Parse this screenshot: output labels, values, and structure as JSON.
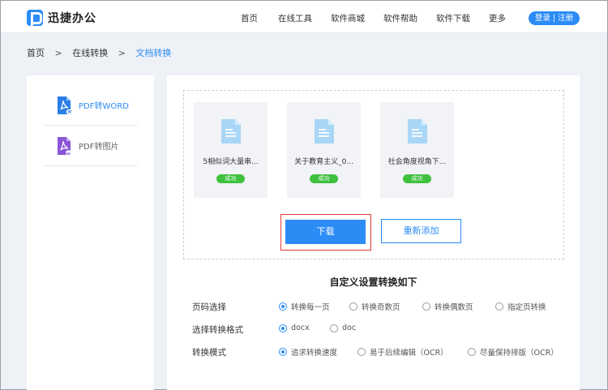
{
  "header": {
    "logo_text": "迅捷办公",
    "nav": [
      "首页",
      "在线工具",
      "软件商城",
      "软件帮助",
      "软件下载",
      "更多"
    ],
    "login_label": "登录 | 注册"
  },
  "breadcrumb": {
    "items": [
      "首页",
      "在线转换",
      "文档转换"
    ],
    "separator": ">"
  },
  "sidebar": {
    "items": [
      {
        "label": "PDF转WORD",
        "icon": "pdf-to-word-icon"
      },
      {
        "label": "PDF转图片",
        "icon": "pdf-to-image-icon"
      }
    ]
  },
  "files": [
    {
      "name": "5相似词大量串...",
      "status": "成功"
    },
    {
      "name": "关于教育主义_0...",
      "status": "成功"
    },
    {
      "name": "社会角度视角下...",
      "status": "成功"
    }
  ],
  "actions": {
    "download_label": "下载",
    "readd_label": "重新添加"
  },
  "settings": {
    "title": "自定义设置转换如下",
    "rows": [
      {
        "label": "页码选择",
        "options": [
          "转换每一页",
          "转换奇数页",
          "转换偶数页",
          "指定页转换"
        ],
        "selected": 0
      },
      {
        "label": "选择转换格式",
        "options": [
          "docx",
          "doc"
        ],
        "selected": 0
      },
      {
        "label": "转换模式",
        "options": [
          "追求转换速度",
          "易于后续编辑（OCR）",
          "尽量保持排版（OCR）"
        ],
        "selected": 0
      }
    ]
  },
  "colors": {
    "accent": "#2b8cf6",
    "success": "#3ec13e",
    "highlight": "#e23a3a"
  }
}
